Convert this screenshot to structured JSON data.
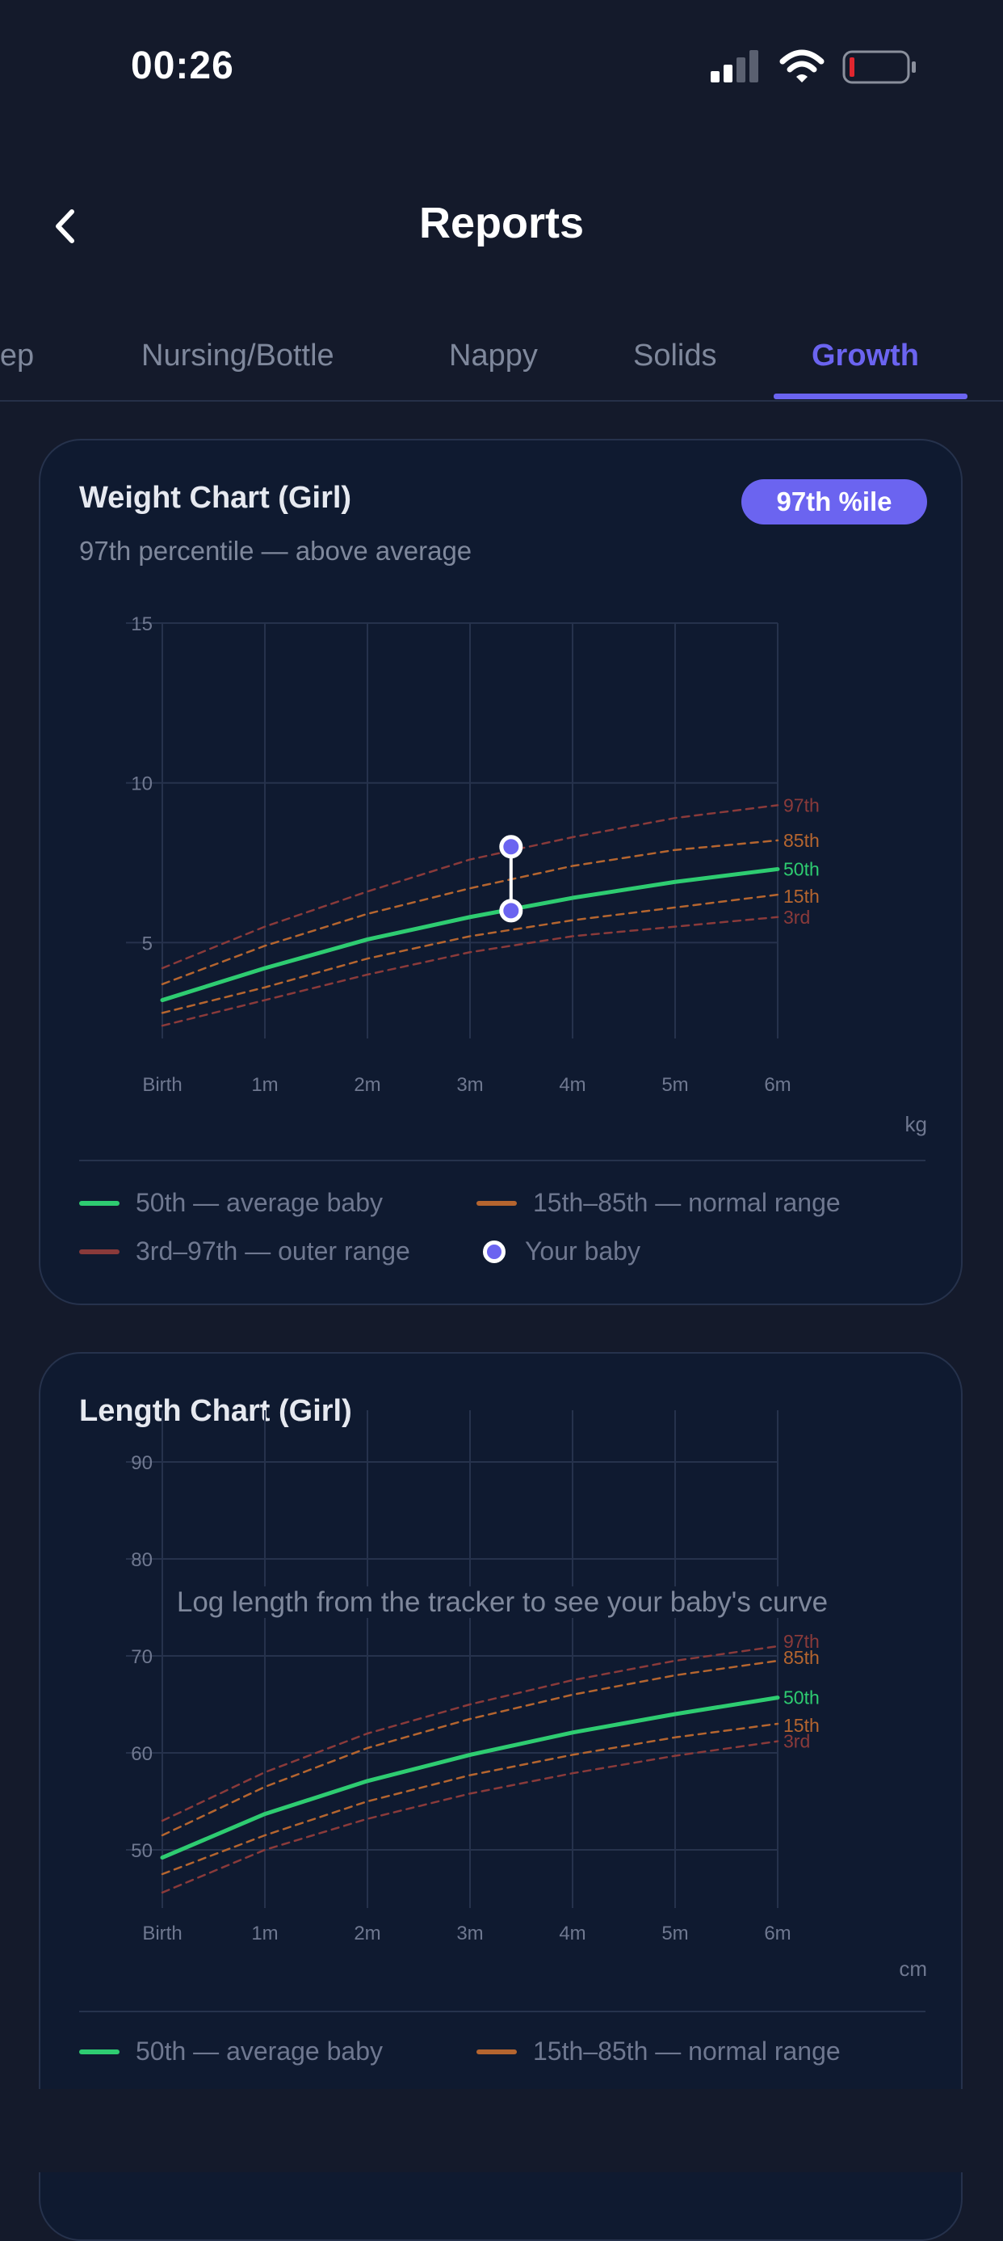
{
  "status_bar": {
    "time": "00:26"
  },
  "header": {
    "title": "Reports"
  },
  "tabs": [
    {
      "label": "Sleep",
      "active": false
    },
    {
      "label": "Nursing/Bottle",
      "active": false
    },
    {
      "label": "Nappy",
      "active": false
    },
    {
      "label": "Solids",
      "active": false
    },
    {
      "label": "Growth",
      "active": true
    }
  ],
  "weight_card": {
    "title": "Weight Chart (Girl)",
    "subtitle": "97th percentile — above average",
    "badge": "97th %ile",
    "unit": "kg",
    "legend": {
      "average": "50th — average baby",
      "normal": "15th–85th — normal range",
      "outer": "3rd–97th — outer range",
      "baby": "Your baby"
    }
  },
  "length_card": {
    "title": "Length Chart (Girl)",
    "empty_message": "Log length from the tracker to see your baby's curve",
    "unit": "cm",
    "legend": {
      "average": "50th — average baby",
      "normal": "15th–85th — normal range"
    }
  },
  "colors": {
    "accent": "#6b64f0",
    "average": "#2ecc71",
    "normal": "#b5652f",
    "outer": "#8a3a3a"
  },
  "chart_data": [
    {
      "type": "line",
      "title": "Weight Chart (Girl)",
      "x": [
        0,
        1,
        2,
        3,
        4,
        5,
        6
      ],
      "x_tick_labels": [
        "Birth",
        "1m",
        "2m",
        "3m",
        "4m",
        "5m",
        "6m"
      ],
      "ylim": [
        2,
        15
      ],
      "y_ticks": [
        5,
        10,
        15
      ],
      "unit": "kg",
      "grid": true,
      "series": [
        {
          "name": "97th",
          "style": "dashed",
          "color": "#8a3a3a",
          "values": [
            4.2,
            5.5,
            6.6,
            7.6,
            8.3,
            8.9,
            9.3
          ]
        },
        {
          "name": "85th",
          "style": "dashed",
          "color": "#b5652f",
          "values": [
            3.7,
            4.9,
            5.9,
            6.7,
            7.4,
            7.9,
            8.2
          ]
        },
        {
          "name": "50th",
          "style": "solid",
          "color": "#2ecc71",
          "values": [
            3.2,
            4.2,
            5.1,
            5.8,
            6.4,
            6.9,
            7.3
          ]
        },
        {
          "name": "15th",
          "style": "dashed",
          "color": "#b5652f",
          "values": [
            2.8,
            3.6,
            4.5,
            5.2,
            5.7,
            6.1,
            6.5
          ]
        },
        {
          "name": "3rd",
          "style": "dashed",
          "color": "#8a3a3a",
          "values": [
            2.4,
            3.2,
            4.0,
            4.7,
            5.2,
            5.5,
            5.8
          ]
        }
      ],
      "baby_points": [
        {
          "x": 3.4,
          "y": 8.0
        },
        {
          "x": 3.4,
          "y": 6.0
        }
      ]
    },
    {
      "type": "line",
      "title": "Length Chart (Girl)",
      "x": [
        0,
        1,
        2,
        3,
        4,
        5,
        6
      ],
      "x_tick_labels": [
        "Birth",
        "1m",
        "2m",
        "3m",
        "4m",
        "5m",
        "6m"
      ],
      "ylim": [
        44,
        92
      ],
      "y_ticks": [
        50,
        60,
        70,
        80,
        90
      ],
      "unit": "cm",
      "grid": true,
      "series": [
        {
          "name": "97th",
          "style": "dashed",
          "color": "#8a3a3a",
          "values": [
            53.0,
            58.0,
            62.0,
            65.0,
            67.5,
            69.5,
            71.0
          ]
        },
        {
          "name": "85th",
          "style": "dashed",
          "color": "#b5652f",
          "values": [
            51.5,
            56.5,
            60.5,
            63.5,
            66.0,
            68.0,
            69.5
          ]
        },
        {
          "name": "50th",
          "style": "solid",
          "color": "#2ecc71",
          "values": [
            49.2,
            53.7,
            57.1,
            59.8,
            62.1,
            64.0,
            65.7
          ]
        },
        {
          "name": "15th",
          "style": "dashed",
          "color": "#b5652f",
          "values": [
            47.5,
            51.5,
            55.0,
            57.7,
            59.8,
            61.6,
            63.0
          ]
        },
        {
          "name": "3rd",
          "style": "dashed",
          "color": "#8a3a3a",
          "values": [
            45.6,
            50.0,
            53.2,
            55.8,
            57.9,
            59.7,
            61.2
          ]
        }
      ]
    }
  ]
}
